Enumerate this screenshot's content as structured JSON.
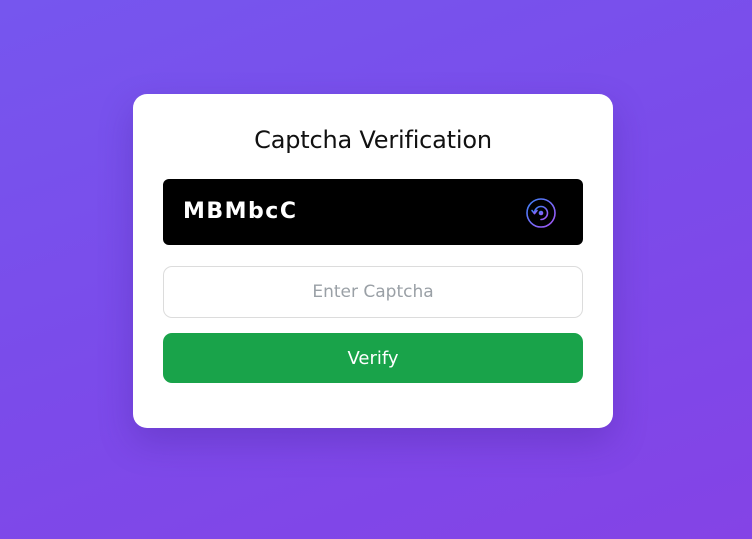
{
  "title": "Captcha Verification",
  "captcha": {
    "code": "MBMbcC",
    "refresh_icon": "refresh-icon"
  },
  "input": {
    "value": "",
    "placeholder": "Enter Captcha"
  },
  "verify_button": {
    "label": "Verify"
  },
  "colors": {
    "background_start": "#7656ee",
    "background_end": "#8443e6",
    "card": "#ffffff",
    "captcha_box": "#000000",
    "button": "#19a34a",
    "icon_gradient_start": "#3b82f6",
    "icon_gradient_end": "#a855f7"
  }
}
